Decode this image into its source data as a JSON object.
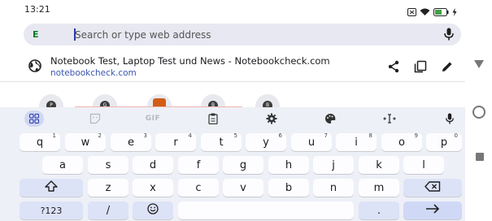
{
  "status": {
    "time": "13:21",
    "icons": [
      "notification-x-icon",
      "wifi-icon",
      "battery-icon",
      "charging-icon"
    ]
  },
  "address_bar": {
    "favicon_letter": "E",
    "placeholder": "Search or type web address",
    "mic_icon": "mic-icon"
  },
  "suggestion": {
    "title": "Notebook Test, Laptop Test und News - Notebookcheck.com",
    "url": "notebookcheck.com",
    "actions": [
      "share-icon",
      "copy-icon",
      "edit-icon"
    ]
  },
  "tiles": [
    {
      "letter": "P"
    },
    {
      "letter": "G"
    },
    {
      "letter": ""
    },
    {
      "letter": "B"
    },
    {
      "letter": "B"
    }
  ],
  "keyboard": {
    "toolbar": {
      "gif_label": "GIF"
    },
    "row1": [
      {
        "key": "q",
        "hint": "1"
      },
      {
        "key": "w",
        "hint": "2"
      },
      {
        "key": "e",
        "hint": "3"
      },
      {
        "key": "r",
        "hint": "4"
      },
      {
        "key": "t",
        "hint": "5"
      },
      {
        "key": "y",
        "hint": "6"
      },
      {
        "key": "u",
        "hint": "7"
      },
      {
        "key": "i",
        "hint": "8"
      },
      {
        "key": "o",
        "hint": "9"
      },
      {
        "key": "p",
        "hint": "0"
      }
    ],
    "row2": [
      "a",
      "s",
      "d",
      "f",
      "g",
      "h",
      "j",
      "k",
      "l"
    ],
    "row3": [
      "z",
      "x",
      "c",
      "v",
      "b",
      "n",
      "m"
    ],
    "row4": {
      "symbols": "?123",
      "slash": "/",
      "period": "."
    }
  },
  "colors": {
    "accent": "#2d3ba8",
    "addr_bg": "#e7e8f1",
    "keyboard_bg": "#eef0f7",
    "url": "#3a56b0"
  }
}
